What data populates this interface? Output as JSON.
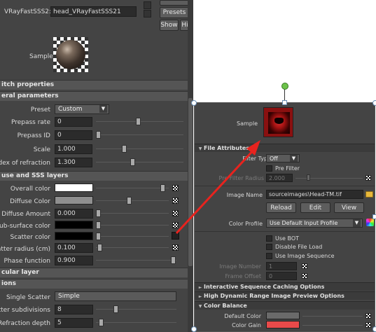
{
  "left_panel": {
    "node_label": "VRayFastSSS2:",
    "node_value": "head_VRayFastSSS21",
    "presets_label": "Presets",
    "show_label": "Show",
    "hide_label": "Hi",
    "sample_label": "Sample",
    "switch_properties": "itch properties",
    "general_parameters": "eral parameters",
    "preset_label": "Preset",
    "preset_value": "Custom",
    "prepass_rate_label": "Prepass rate",
    "prepass_rate_value": "0",
    "prepass_id_label": "Prepass ID",
    "prepass_id_value": "0",
    "scale_label": "Scale",
    "scale_value": "1.000",
    "ior_label": "Index of refraction",
    "ior_value": "1.300",
    "layers_header": "use and SSS layers",
    "overall_color_label": "Overall color",
    "diffuse_color_label": "Diffuse Color",
    "diffuse_amount_label": "Diffuse Amount",
    "diffuse_amount_value": "0.000",
    "subsurface_color_label": "Sub-surface color",
    "scatter_color_label": "Scatter color",
    "scatter_radius_label": "Scatter radius (cm)",
    "scatter_radius_value": "0.100",
    "phase_function_label": "Phase function",
    "phase_function_value": "0.900",
    "specular_layer": "cular layer",
    "options": "ions",
    "single_scatter_label": "Single Scatter",
    "single_scatter_value": "Simple",
    "scatter_subdiv_label": "catter subdivisions",
    "scatter_subdiv_value": "8",
    "refraction_depth_label": "Refraction depth",
    "refraction_depth_value": "5"
  },
  "right_panel": {
    "sample_label": "Sample",
    "file_attributes": "File Attributes",
    "filter_type_label": "Filter Type",
    "filter_type_value": "Off",
    "pre_filter_label": "Pre Filter",
    "pre_filter_radius_label": "Pre Filter Radius",
    "pre_filter_radius_value": "2.000",
    "image_name_label": "Image Name",
    "image_name_value": "sourceimages\\Head-TM.tif",
    "reload_label": "Reload",
    "edit_label": "Edit",
    "view_label": "View",
    "color_profile_label": "Color Profile",
    "color_profile_value": "Use Default Input Profile",
    "use_bot_label": "Use BOT",
    "disable_file_load_label": "Disable File Load",
    "use_image_sequence_label": "Use Image Sequence",
    "image_number_label": "Image Number",
    "image_number_value": "1",
    "frame_offset_label": "Frame Offset",
    "frame_offset_value": "0",
    "interactive_caching": "Interactive Sequence Caching Options",
    "hdr_preview": "High Dynamic Range Image Preview Options",
    "color_balance": "Color Balance",
    "default_color_label": "Default Color",
    "color_gain_label": "Color Gain"
  },
  "colors": {
    "arrow": "#e8231e",
    "color_gain": "#e84a4a",
    "handle_green": "#6cc24a"
  }
}
